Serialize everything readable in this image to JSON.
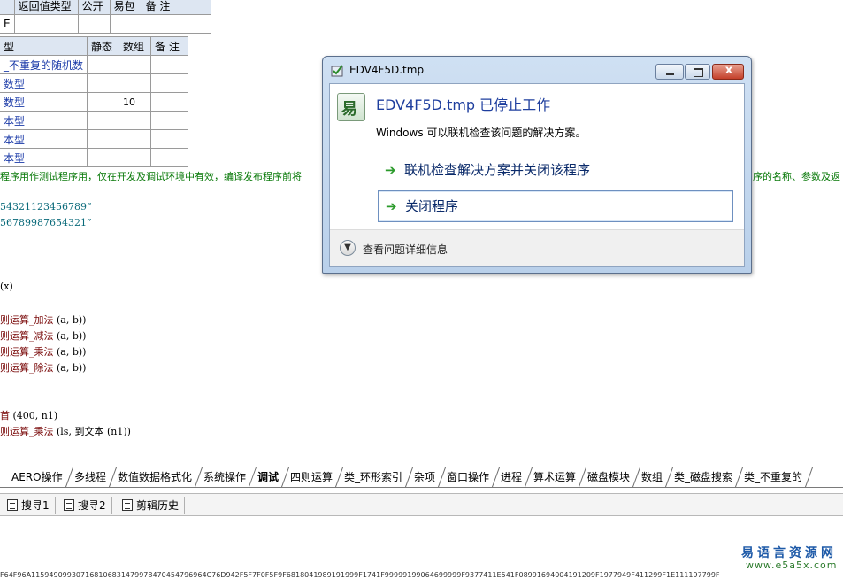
{
  "table1": {
    "headers": [
      "返回值类型",
      "公开",
      "易包",
      "备 注"
    ],
    "row_stub": "E"
  },
  "table2": {
    "headers": [
      "型",
      "静态",
      "数组",
      "备 注"
    ],
    "rows": [
      {
        "name": "_不重复的随机数",
        "static": "",
        "array": "",
        "note": ""
      },
      {
        "name": "数型",
        "static": "",
        "array": "",
        "note": ""
      },
      {
        "name": "数型",
        "static": "",
        "array": "10",
        "note": ""
      },
      {
        "name": "本型",
        "static": "",
        "array": "",
        "note": ""
      },
      {
        "name": "本型",
        "static": "",
        "array": "",
        "note": ""
      },
      {
        "name": "本型",
        "static": "",
        "array": "",
        "note": ""
      }
    ]
  },
  "code": {
    "comment": "程序用作测试程序用，仅在开发及调试环境中有效，编译发布程序前将",
    "comment_tail": "序的名称、参数及返",
    "str1": "54321123456789”",
    "str2": "56789987654321”",
    "line_x": "(x)",
    "ops": [
      {
        "name": "则运算_加法",
        "args": "(a, b))"
      },
      {
        "name": "则运算_减法",
        "args": "(a, b))"
      },
      {
        "name": "则运算_乘法",
        "args": "(a, b))"
      },
      {
        "name": "则运算_除法",
        "args": "(a, b))"
      }
    ],
    "line_a_name": "首",
    "line_a_args": "(400, n1)",
    "line_b_name": "则运算_乘法",
    "line_b_args": "(ls, 到文本 (n1))"
  },
  "tabs": [
    {
      "label": "AERO操作",
      "active": false
    },
    {
      "label": "多线程",
      "active": false
    },
    {
      "label": "数值数据格式化",
      "active": false
    },
    {
      "label": "系统操作",
      "active": false
    },
    {
      "label": "调试",
      "active": true
    },
    {
      "label": "四则运算",
      "active": false
    },
    {
      "label": "类_环形索引",
      "active": false
    },
    {
      "label": "杂项",
      "active": false
    },
    {
      "label": "窗口操作",
      "active": false
    },
    {
      "label": "进程",
      "active": false
    },
    {
      "label": "算术运算",
      "active": false
    },
    {
      "label": "磁盘模块",
      "active": false
    },
    {
      "label": "数组",
      "active": false
    },
    {
      "label": "类_磁盘搜索",
      "active": false
    },
    {
      "label": "类_不重复的",
      "active": false
    }
  ],
  "bottom_tools": {
    "search1": "搜寻1",
    "search2": "搜寻2",
    "clip_history": "剪辑历史"
  },
  "dialog": {
    "title": "EDV4F5D.tmp",
    "heading": "EDV4F5D.tmp 已停止工作",
    "description": "Windows 可以联机检查该问题的解决方案。",
    "option_check": "联机检查解决方案并关闭该程序",
    "option_close": "关闭程序",
    "details": "查看问题详细信息",
    "close_glyph": "x"
  },
  "watermark": {
    "name": "易语言资源网",
    "url": "www.e5a5x.com"
  },
  "bottom_strip": "F64F96A115949099307168106831479978470454796964C76D942F5F7F0F5F9F6818041989191999F1741F99999199064699999F9377411E541F08991694004191209F1977949F411299F1E111197799F"
}
